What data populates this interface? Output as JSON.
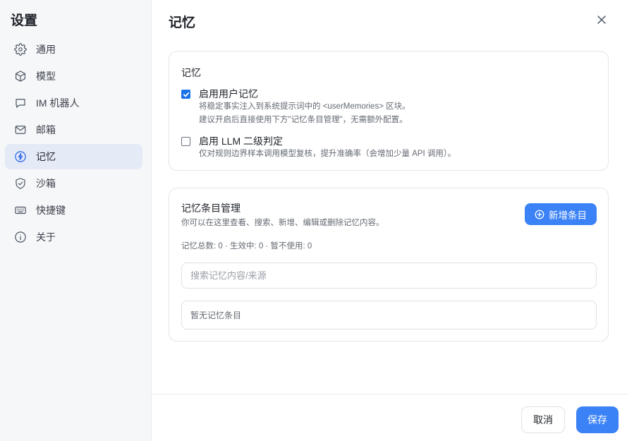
{
  "sidebar": {
    "title": "设置",
    "items": [
      {
        "label": "通用",
        "icon": "gear-icon"
      },
      {
        "label": "模型",
        "icon": "cube-icon"
      },
      {
        "label": "IM 机器人",
        "icon": "chat-bubble-icon"
      },
      {
        "label": "邮箱",
        "icon": "mail-icon"
      },
      {
        "label": "记忆",
        "icon": "lightning-icon"
      },
      {
        "label": "沙箱",
        "icon": "shield-check-icon"
      },
      {
        "label": "快捷键",
        "icon": "keyboard-icon"
      },
      {
        "label": "关于",
        "icon": "info-icon"
      }
    ],
    "active_index": 4
  },
  "main": {
    "title": "记忆",
    "memory_card": {
      "title": "记忆",
      "options": [
        {
          "label": "启用用户记忆",
          "checked": true,
          "desc1": "将稳定事实注入到系统提示词中的 <userMemories> 区块。",
          "desc2": "建议开启后直接使用下方\"记忆条目管理\"，无需额外配置。"
        },
        {
          "label": "启用 LLM 二级判定",
          "checked": false,
          "desc1": "仅对规则边界样本调用模型复核，提升准确率（会增加少量 API 调用）。"
        }
      ]
    },
    "entries_card": {
      "title": "记忆条目管理",
      "desc": "你可以在这里查看、搜索、新增、编辑或删除记忆内容。",
      "add_label": "新增条目",
      "stats": "记忆总数: 0 · 生效中: 0 · 暂不使用: 0",
      "search_placeholder": "搜索记忆内容/来源",
      "search_value": "",
      "empty_text": "暂无记忆条目"
    },
    "footer": {
      "cancel_label": "取消",
      "save_label": "保存"
    }
  },
  "colors": {
    "accent": "#3b82f6",
    "active_nav_bg": "#e4eaf6",
    "sidebar_bg": "#f6f7f9"
  }
}
